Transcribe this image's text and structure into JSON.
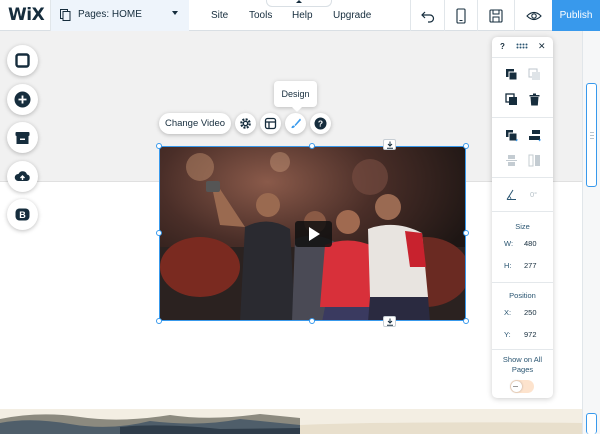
{
  "topbar": {
    "logo": "WiX",
    "pages_label": "Pages: HOME",
    "nav": [
      "Site",
      "Tools",
      "Help",
      "Upgrade"
    ],
    "publish_label": "Publish"
  },
  "toolbar": {
    "tooltip": "Design",
    "change_video_label": "Change Video"
  },
  "panel": {
    "help_label": "?",
    "close_label": "✕",
    "rotation_value": "0°",
    "size_label": "Size",
    "width_key": "W:",
    "width_value": "480",
    "height_key": "H:",
    "height_value": "277",
    "position_label": "Position",
    "x_key": "X:",
    "x_value": "250",
    "y_key": "Y:",
    "y_value": "972",
    "show_all_label": "Show on All Pages",
    "show_all_on": false
  },
  "colors": {
    "accent": "#3899ec",
    "text": "#162d3d",
    "pages_bg": "#eef4fb"
  }
}
